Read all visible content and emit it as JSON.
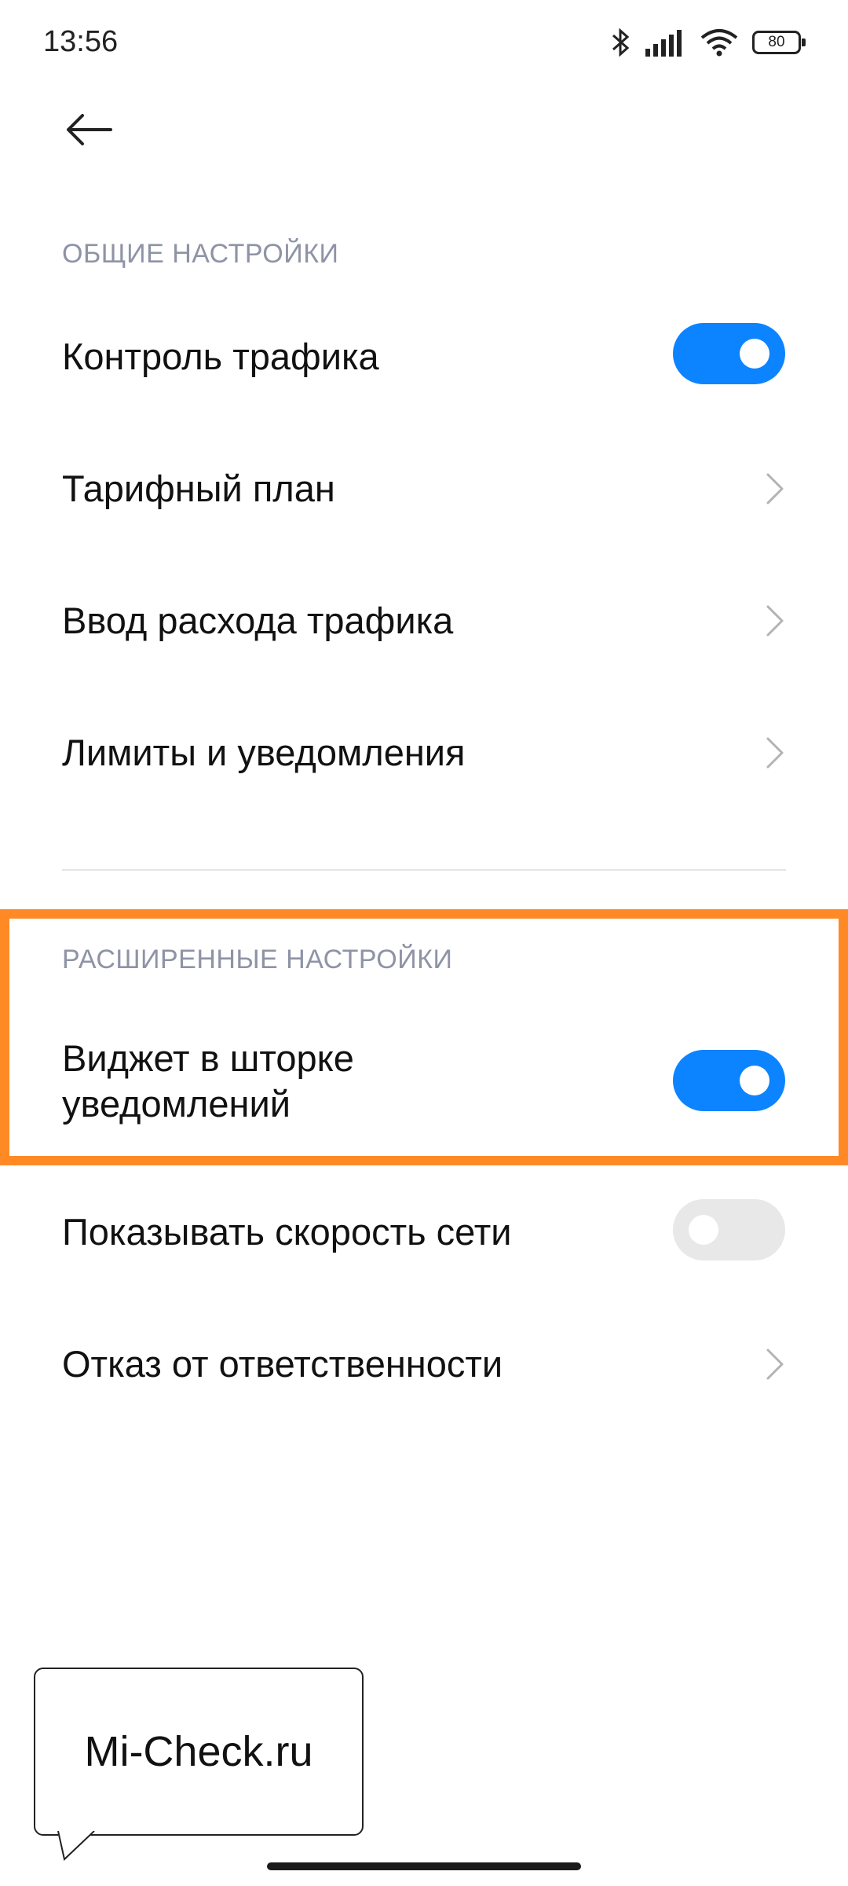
{
  "status_bar": {
    "time": "13:56",
    "battery": "80",
    "icons": [
      "bluetooth-icon",
      "signal-icon",
      "wifi-icon",
      "battery-icon"
    ]
  },
  "header": {
    "back_icon": "back-arrow-icon"
  },
  "general": {
    "title": "ОБЩИЕ НАСТРОЙКИ",
    "items": [
      {
        "label": "Контроль трафика",
        "control": "toggle",
        "state": "on"
      },
      {
        "label": "Тарифный план",
        "control": "chevron"
      },
      {
        "label": "Ввод расхода трафика",
        "control": "chevron"
      },
      {
        "label": "Лимиты и уведомления",
        "control": "chevron"
      }
    ]
  },
  "advanced": {
    "title": "РАСШИРЕННЫЕ НАСТРОЙКИ",
    "items": [
      {
        "label": "Виджет в шторке уведомлений",
        "control": "toggle",
        "state": "on"
      },
      {
        "label": "Показывать скорость сети",
        "control": "toggle",
        "state": "off"
      },
      {
        "label": "Отказ от ответственности",
        "control": "chevron"
      }
    ]
  },
  "colors": {
    "accent": "#0d84ff",
    "highlight": "#ff8a25",
    "section": "#8e93a6"
  },
  "watermark": {
    "text": "Mi-Check.ru"
  }
}
